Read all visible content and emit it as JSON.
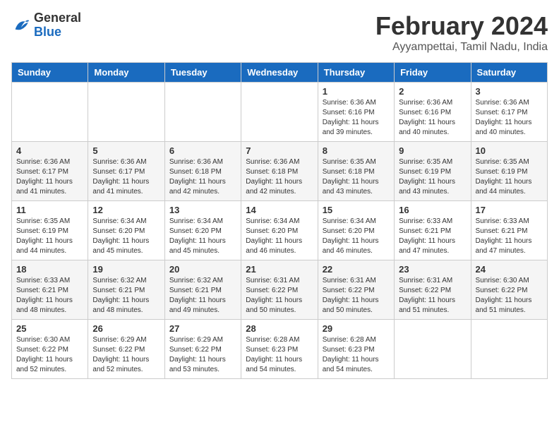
{
  "header": {
    "logo_line1": "General",
    "logo_line2": "Blue",
    "main_title": "February 2024",
    "subtitle": "Ayyampettai, Tamil Nadu, India"
  },
  "calendar": {
    "days_of_week": [
      "Sunday",
      "Monday",
      "Tuesday",
      "Wednesday",
      "Thursday",
      "Friday",
      "Saturday"
    ],
    "weeks": [
      [
        {
          "num": "",
          "info": ""
        },
        {
          "num": "",
          "info": ""
        },
        {
          "num": "",
          "info": ""
        },
        {
          "num": "",
          "info": ""
        },
        {
          "num": "1",
          "info": "Sunrise: 6:36 AM\nSunset: 6:16 PM\nDaylight: 11 hours\nand 39 minutes."
        },
        {
          "num": "2",
          "info": "Sunrise: 6:36 AM\nSunset: 6:16 PM\nDaylight: 11 hours\nand 40 minutes."
        },
        {
          "num": "3",
          "info": "Sunrise: 6:36 AM\nSunset: 6:17 PM\nDaylight: 11 hours\nand 40 minutes."
        }
      ],
      [
        {
          "num": "4",
          "info": "Sunrise: 6:36 AM\nSunset: 6:17 PM\nDaylight: 11 hours\nand 41 minutes."
        },
        {
          "num": "5",
          "info": "Sunrise: 6:36 AM\nSunset: 6:17 PM\nDaylight: 11 hours\nand 41 minutes."
        },
        {
          "num": "6",
          "info": "Sunrise: 6:36 AM\nSunset: 6:18 PM\nDaylight: 11 hours\nand 42 minutes."
        },
        {
          "num": "7",
          "info": "Sunrise: 6:36 AM\nSunset: 6:18 PM\nDaylight: 11 hours\nand 42 minutes."
        },
        {
          "num": "8",
          "info": "Sunrise: 6:35 AM\nSunset: 6:18 PM\nDaylight: 11 hours\nand 43 minutes."
        },
        {
          "num": "9",
          "info": "Sunrise: 6:35 AM\nSunset: 6:19 PM\nDaylight: 11 hours\nand 43 minutes."
        },
        {
          "num": "10",
          "info": "Sunrise: 6:35 AM\nSunset: 6:19 PM\nDaylight: 11 hours\nand 44 minutes."
        }
      ],
      [
        {
          "num": "11",
          "info": "Sunrise: 6:35 AM\nSunset: 6:19 PM\nDaylight: 11 hours\nand 44 minutes."
        },
        {
          "num": "12",
          "info": "Sunrise: 6:34 AM\nSunset: 6:20 PM\nDaylight: 11 hours\nand 45 minutes."
        },
        {
          "num": "13",
          "info": "Sunrise: 6:34 AM\nSunset: 6:20 PM\nDaylight: 11 hours\nand 45 minutes."
        },
        {
          "num": "14",
          "info": "Sunrise: 6:34 AM\nSunset: 6:20 PM\nDaylight: 11 hours\nand 46 minutes."
        },
        {
          "num": "15",
          "info": "Sunrise: 6:34 AM\nSunset: 6:20 PM\nDaylight: 11 hours\nand 46 minutes."
        },
        {
          "num": "16",
          "info": "Sunrise: 6:33 AM\nSunset: 6:21 PM\nDaylight: 11 hours\nand 47 minutes."
        },
        {
          "num": "17",
          "info": "Sunrise: 6:33 AM\nSunset: 6:21 PM\nDaylight: 11 hours\nand 47 minutes."
        }
      ],
      [
        {
          "num": "18",
          "info": "Sunrise: 6:33 AM\nSunset: 6:21 PM\nDaylight: 11 hours\nand 48 minutes."
        },
        {
          "num": "19",
          "info": "Sunrise: 6:32 AM\nSunset: 6:21 PM\nDaylight: 11 hours\nand 48 minutes."
        },
        {
          "num": "20",
          "info": "Sunrise: 6:32 AM\nSunset: 6:21 PM\nDaylight: 11 hours\nand 49 minutes."
        },
        {
          "num": "21",
          "info": "Sunrise: 6:31 AM\nSunset: 6:22 PM\nDaylight: 11 hours\nand 50 minutes."
        },
        {
          "num": "22",
          "info": "Sunrise: 6:31 AM\nSunset: 6:22 PM\nDaylight: 11 hours\nand 50 minutes."
        },
        {
          "num": "23",
          "info": "Sunrise: 6:31 AM\nSunset: 6:22 PM\nDaylight: 11 hours\nand 51 minutes."
        },
        {
          "num": "24",
          "info": "Sunrise: 6:30 AM\nSunset: 6:22 PM\nDaylight: 11 hours\nand 51 minutes."
        }
      ],
      [
        {
          "num": "25",
          "info": "Sunrise: 6:30 AM\nSunset: 6:22 PM\nDaylight: 11 hours\nand 52 minutes."
        },
        {
          "num": "26",
          "info": "Sunrise: 6:29 AM\nSunset: 6:22 PM\nDaylight: 11 hours\nand 52 minutes."
        },
        {
          "num": "27",
          "info": "Sunrise: 6:29 AM\nSunset: 6:22 PM\nDaylight: 11 hours\nand 53 minutes."
        },
        {
          "num": "28",
          "info": "Sunrise: 6:28 AM\nSunset: 6:23 PM\nDaylight: 11 hours\nand 54 minutes."
        },
        {
          "num": "29",
          "info": "Sunrise: 6:28 AM\nSunset: 6:23 PM\nDaylight: 11 hours\nand 54 minutes."
        },
        {
          "num": "",
          "info": ""
        },
        {
          "num": "",
          "info": ""
        }
      ]
    ]
  }
}
